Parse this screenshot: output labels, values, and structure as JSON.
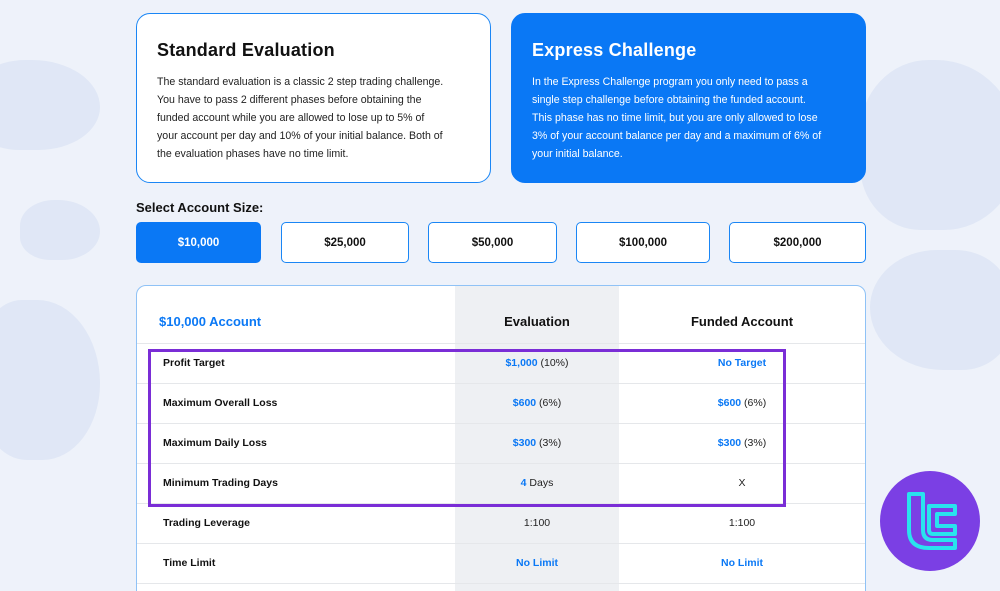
{
  "cards": {
    "standard": {
      "title": "Standard Evaluation",
      "lines": [
        "The standard evaluation is a classic 2 step trading challenge.",
        "You have to pass 2 different phases before obtaining the",
        "funded account while you are allowed to lose up to 5% of",
        "your account per day and 10% of your initial balance. Both of",
        "the evaluation phases have no time limit."
      ]
    },
    "express": {
      "title": "Express Challenge",
      "lines": [
        "In the Express Challenge program you only need to pass a",
        "single step challenge before obtaining the funded account.",
        "This phase has no time limit, but you are only allowed to lose",
        "3% of your account balance per day and a maximum of 6% of",
        "your initial balance."
      ]
    }
  },
  "account_size": {
    "label": "Select Account Size:",
    "options": [
      "$10,000",
      "$25,000",
      "$50,000",
      "$100,000",
      "$200,000"
    ],
    "selected": "$10,000"
  },
  "table": {
    "account_title": "$10,000 Account",
    "col_evaluation": "Evaluation",
    "col_funded": "Funded Account",
    "rows": [
      {
        "label": "Profit Target",
        "eval_main": "$1,000",
        "eval_note": " (10%)",
        "fund_main": "No Target",
        "fund_note": ""
      },
      {
        "label": "Maximum Overall Loss",
        "eval_main": "$600",
        "eval_note": " (6%)",
        "fund_main": "$600",
        "fund_note": " (6%)"
      },
      {
        "label": "Maximum Daily Loss",
        "eval_main": "$300",
        "eval_note": " (3%)",
        "fund_main": "$300",
        "fund_note": " (3%)"
      },
      {
        "label": "Minimum Trading Days",
        "eval_main": "4",
        "eval_note": " Days",
        "fund_main": "",
        "fund_note": "X"
      },
      {
        "label": "Trading Leverage",
        "eval_main": "",
        "eval_note": "1:100",
        "fund_main": "",
        "fund_note": "1:100"
      },
      {
        "label": "Time Limit",
        "eval_main": "No Limit",
        "eval_note": "",
        "fund_main": "No Limit",
        "fund_note": ""
      }
    ]
  },
  "colors": {
    "accent": "#0a78f5",
    "highlight": "#7a2dd6",
    "logo_bg": "#7b3fe4",
    "logo_mark": "#29e3ee"
  },
  "logo": {
    "icon": "tradingfinder-logo-icon"
  }
}
